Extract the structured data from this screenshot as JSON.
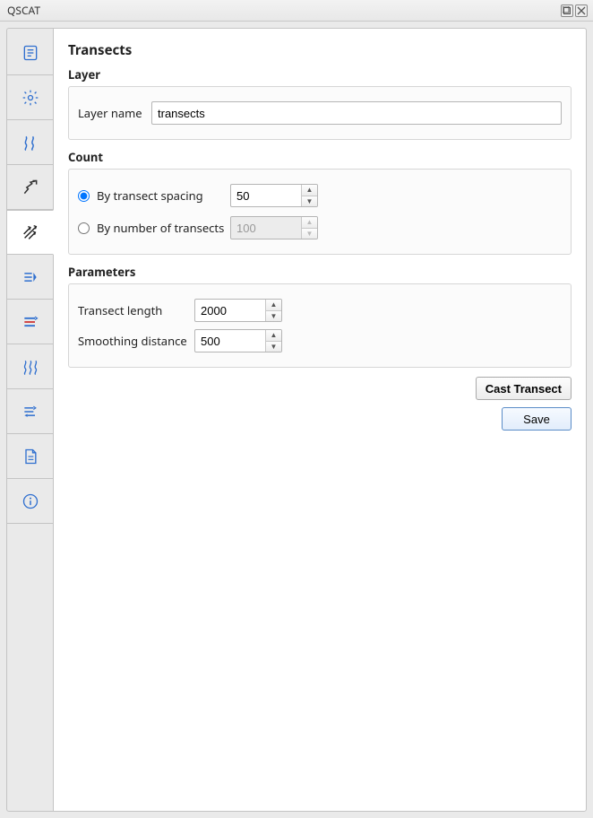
{
  "window": {
    "title": "QSCAT"
  },
  "sidebar": {
    "items": [
      {
        "name": "overview",
        "icon": "list-icon",
        "active": false
      },
      {
        "name": "settings",
        "icon": "gear-icon",
        "active": false
      },
      {
        "name": "shorelines",
        "icon": "waves-icon",
        "active": false
      },
      {
        "name": "baseline",
        "icon": "zigzag-up-icon",
        "active": false
      },
      {
        "name": "transects",
        "icon": "transects-icon",
        "active": true
      },
      {
        "name": "compute",
        "icon": "flow-right-icon",
        "active": false
      },
      {
        "name": "compare",
        "icon": "stack-colored-icon",
        "active": false
      },
      {
        "name": "rates",
        "icon": "triple-wave-icon",
        "active": false
      },
      {
        "name": "export",
        "icon": "flow-return-icon",
        "active": false
      },
      {
        "name": "report",
        "icon": "document-icon",
        "active": false
      },
      {
        "name": "about",
        "icon": "info-icon",
        "active": false
      }
    ]
  },
  "page": {
    "title": "Transects",
    "sections": {
      "layer": {
        "title": "Layer",
        "fields": {
          "layer_name_label": "Layer name",
          "layer_name_value": "transects"
        }
      },
      "count": {
        "title": "Count",
        "by_spacing_label": "By transect spacing",
        "by_spacing_value": "50",
        "by_number_label": "By number of transects",
        "by_number_value": "100",
        "selected": "spacing"
      },
      "parameters": {
        "title": "Parameters",
        "length_label": "Transect length",
        "length_value": "2000",
        "smoothing_label": "Smoothing distance",
        "smoothing_value": "500"
      }
    },
    "actions": {
      "cast_label": "Cast Transect",
      "save_label": "Save"
    }
  }
}
